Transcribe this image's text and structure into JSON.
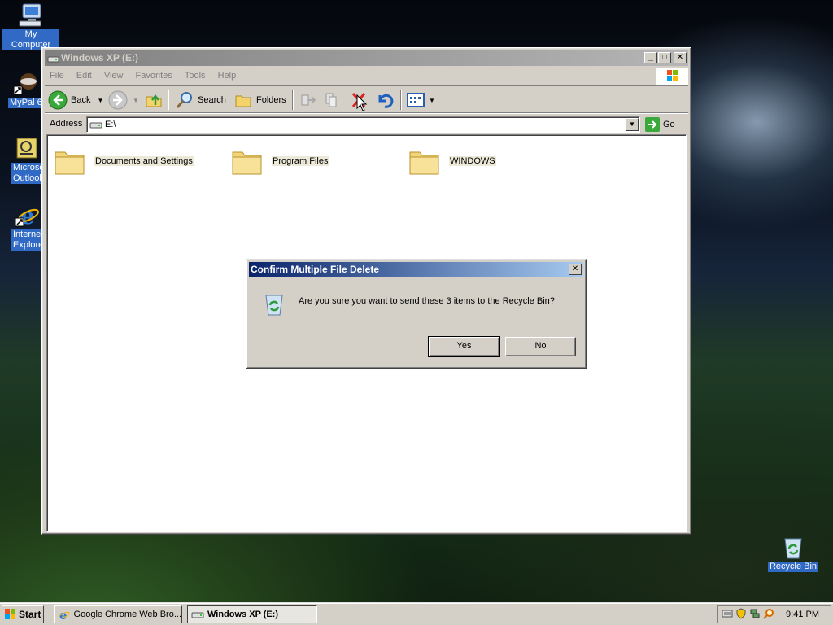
{
  "desktop": {
    "icons": [
      {
        "label": "My Computer",
        "icon": "my-computer-icon"
      },
      {
        "label": "MyPal 6",
        "icon": "mypal-icon"
      },
      {
        "label": "Microsoft Outlook",
        "icon": "outlook-icon"
      },
      {
        "label": "Internet Explorer",
        "icon": "internet-explorer-icon"
      },
      {
        "label": "Recycle Bin",
        "icon": "recycle-bin-icon"
      }
    ]
  },
  "window": {
    "title": "Windows XP (E:)",
    "menu": [
      "File",
      "Edit",
      "View",
      "Favorites",
      "Tools",
      "Help"
    ],
    "toolbar": {
      "back": "Back",
      "search": "Search",
      "folders": "Folders"
    },
    "address": {
      "label": "Address",
      "value": "E:\\",
      "go": "Go"
    },
    "files": [
      {
        "name": "Documents and Settings"
      },
      {
        "name": "Program Files"
      },
      {
        "name": "WINDOWS"
      }
    ]
  },
  "dialog": {
    "title": "Confirm Multiple File Delete",
    "message": "Are you sure you want to send these 3 items to the Recycle Bin?",
    "yes": "Yes",
    "no": "No"
  },
  "taskbar": {
    "start": "Start",
    "tasks": [
      {
        "label": "Google Chrome Web Bro...",
        "active": false
      },
      {
        "label": "Windows XP (E:)",
        "active": true
      }
    ],
    "clock": "9:41 PM"
  },
  "colors": {
    "selection": "#316ac5",
    "dialog_title": "#0a246a",
    "face": "#d4d0c8"
  }
}
